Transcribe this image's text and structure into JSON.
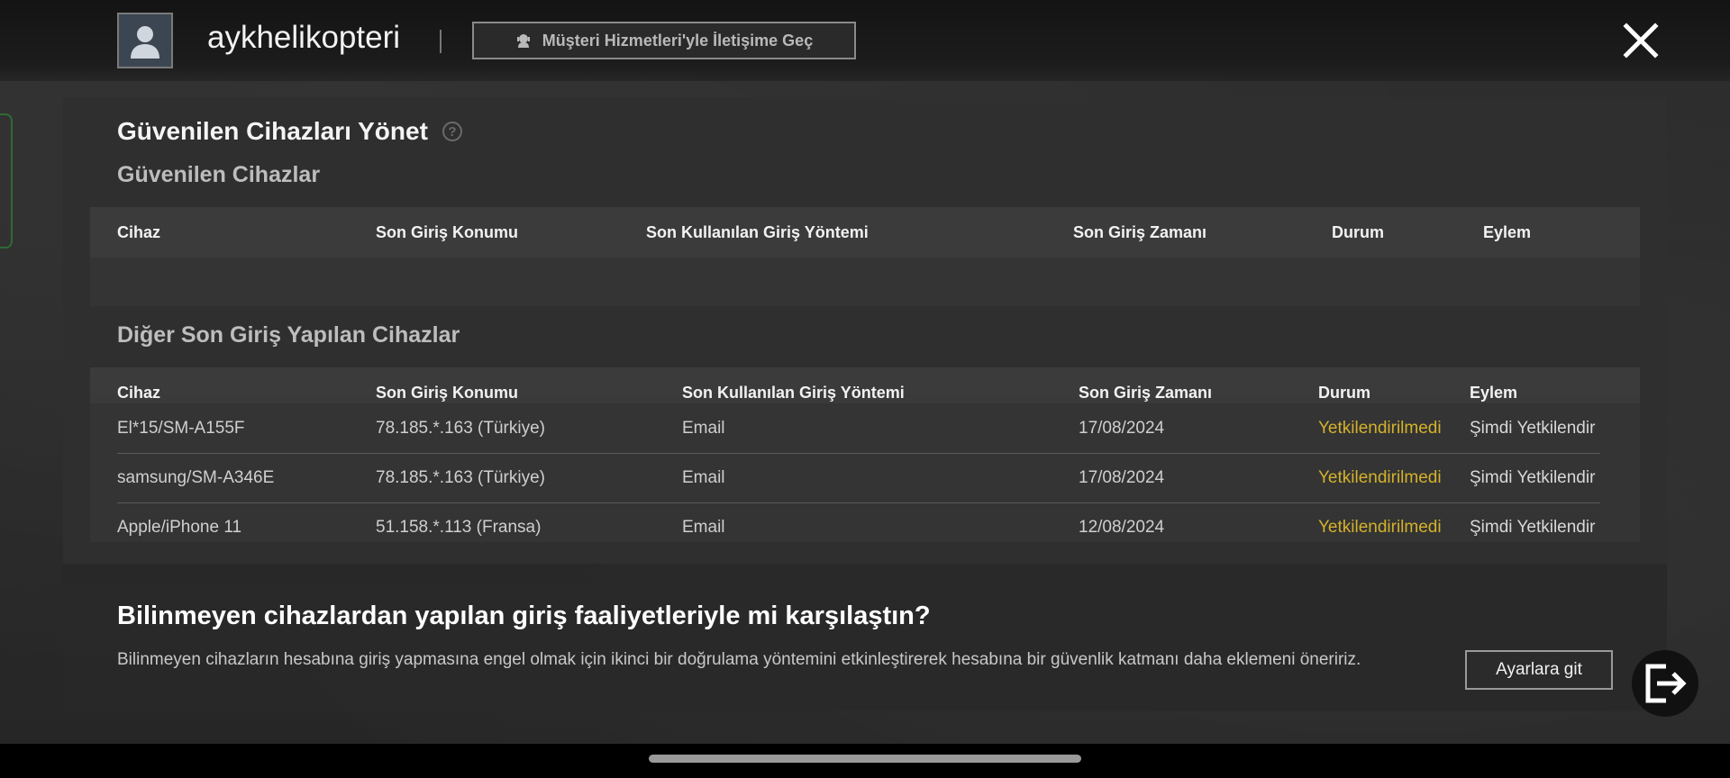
{
  "header": {
    "username": "aykhelikopteri",
    "support_label": "Müşteri Hizmetleri'yle İletişime Geç"
  },
  "page": {
    "title": "Güvenilen Cihazları Yönet",
    "help_glyph": "?"
  },
  "trusted": {
    "heading": "Güvenilen Cihazlar",
    "columns": [
      "Cihaz",
      "Son Giriş Konumu",
      "Son Kullanılan Giriş Yöntemi",
      "Son Giriş Zamanı",
      "Durum",
      "Eylem"
    ]
  },
  "other": {
    "heading": "Diğer Son Giriş Yapılan Cihazlar",
    "columns": [
      "Cihaz",
      "Son Giriş Konumu",
      "Son Kullanılan Giriş Yöntemi",
      "Son Giriş Zamanı",
      "Durum",
      "Eylem"
    ],
    "rows": [
      {
        "device": "El*15/SM-A155F",
        "location": "78.185.*.163 (Türkiye)",
        "method": "Email",
        "time": "17/08/2024",
        "status": "Yetkilendirilmedi",
        "action": "Şimdi Yetkilendir"
      },
      {
        "device": "samsung/SM-A346E",
        "location": "78.185.*.163 (Türkiye)",
        "method": "Email",
        "time": "17/08/2024",
        "status": "Yetkilendirilmedi",
        "action": "Şimdi Yetkilendir"
      },
      {
        "device": "Apple/iPhone 11",
        "location": "51.158.*.113 (Fransa)",
        "method": "Email",
        "time": "12/08/2024",
        "status": "Yetkilendirilmedi",
        "action": "Şimdi Yetkilendir"
      }
    ]
  },
  "notice": {
    "title": "Bilinmeyen cihazlardan yapılan giriş faaliyetleriyle mi karşılaştın?",
    "text": "Bilinmeyen cihazların hesabına giriş yapmasına engel olmak için ikinci bir doğrulama yöntemini etkinleştirerek hesabına bir güvenlik katmanı daha eklemeni öneririz.",
    "button_label": "Ayarlara git"
  },
  "icons": {
    "avatar": "avatar-icon",
    "support": "support-agent-icon",
    "close": "close-icon",
    "help": "help-icon",
    "logout": "logout-icon"
  },
  "colors": {
    "status_unauthorized": "#d4b12c"
  }
}
